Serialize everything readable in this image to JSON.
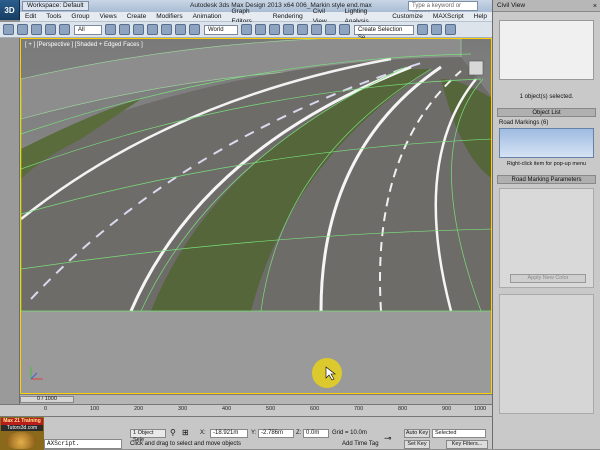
{
  "app": {
    "logo": "3D",
    "workspace": "Workspace: Default",
    "title": "Autodesk 3ds Max Design 2013 x64     006_Markin style end.max",
    "search_placeholder": "Type a keyword or phrase"
  },
  "menu": [
    "Edit",
    "Tools",
    "Group",
    "Views",
    "Create",
    "Modifiers",
    "Animation",
    "Graph Editors",
    "Rendering",
    "Civil View",
    "Lighting Analysis",
    "Customize",
    "MAXScript",
    "Help"
  ],
  "toolbar": {
    "filter": "All",
    "coord_system": "World",
    "selection_set_placeholder": "Create Selection Se"
  },
  "viewport": {
    "label": "[ + ] [Perspective ] [Shaded + Edged Faces ]"
  },
  "command_panel": {
    "title": "Civil View",
    "close": "×",
    "objects_selected": "1 object(s) selected.",
    "object_list_rollout": "Object List",
    "road_markings_label": "Road Markings (6)",
    "right_click_hint": "Right-click item for pop-up menu",
    "params_rollout": "Road Marking Parameters",
    "apply_button": "Apply New Color"
  },
  "timeline": {
    "frame": "0 / 1000",
    "ticks": [
      "0",
      "100",
      "200",
      "300",
      "400",
      "500",
      "600",
      "700",
      "800",
      "900",
      "1000"
    ]
  },
  "status": {
    "logo_top": "Max 21 Training",
    "logo_sub": "Tutors3d.com",
    "maxscript": "AXScript.",
    "objects_selected": "1 Object Sele",
    "hint": "Click and drag to select and move objects",
    "x_label": "X:",
    "x_value": "-18.921m",
    "y_label": "Y:",
    "y_value": "-2.786m",
    "z_label": "Z:",
    "z_value": "0.0m",
    "grid": "Grid = 10.0m",
    "add_time_tag": "Add Time Tag",
    "auto_key": "Auto Key",
    "set_key": "Set Key",
    "selected": "Selected",
    "key_filters": "Key Filters..."
  },
  "colors": {
    "viewport_border": "#ffd000",
    "grass": "#55663a",
    "road": "#6e6c68",
    "grid_lines": "#79e07a",
    "cursor": "#e6d11a"
  }
}
